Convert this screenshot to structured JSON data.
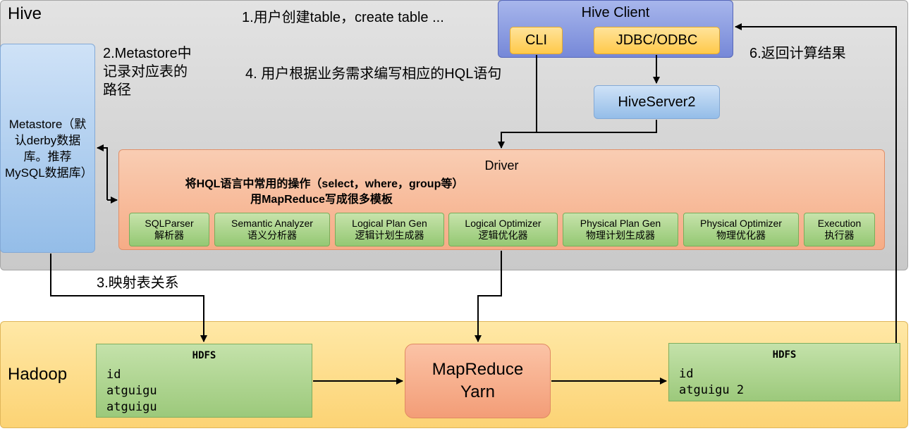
{
  "hive": {
    "label": "Hive"
  },
  "hadoop": {
    "label": "Hadoop"
  },
  "notes": {
    "step1": "1.用户创建table，create table ...",
    "step2": "2.Metastore中记录对应表的路径",
    "step3": "3.映射表关系",
    "step4": "4. 用户根据业务需求编写相应的HQL语句",
    "step6": "6.返回计算结果"
  },
  "hive_client": {
    "title": "Hive Client",
    "cli": "CLI",
    "jdbc": "JDBC/ODBC"
  },
  "hiveserver2": "HiveServer2",
  "metastore": "Metastore（默认derby数据库。推荐MySQL数据库）",
  "driver": {
    "title": "Driver",
    "description": "将HQL语言中常用的操作（select，where，group等）用MapReduce写成很多模板",
    "components": [
      {
        "en": "SQLParser",
        "zh": "解析器"
      },
      {
        "en": "Semantic Analyzer",
        "zh": "语义分析器"
      },
      {
        "en": "Logical Plan Gen",
        "zh": "逻辑计划生成器"
      },
      {
        "en": "Logical Optimizer",
        "zh": "逻辑优化器"
      },
      {
        "en": "Physical Plan Gen",
        "zh": "物理计划生成器"
      },
      {
        "en": "Physical Optimizer",
        "zh": "物理优化器"
      },
      {
        "en": "Execution",
        "zh": "执行器"
      }
    ]
  },
  "hdfs_in": {
    "title": "HDFS",
    "lines": [
      "id",
      "atguigu",
      "atguigu"
    ]
  },
  "hdfs_out": {
    "title": "HDFS",
    "lines": [
      "id",
      "atguigu 2"
    ]
  },
  "mapreduce": {
    "line1": "MapReduce",
    "line2": "Yarn"
  }
}
